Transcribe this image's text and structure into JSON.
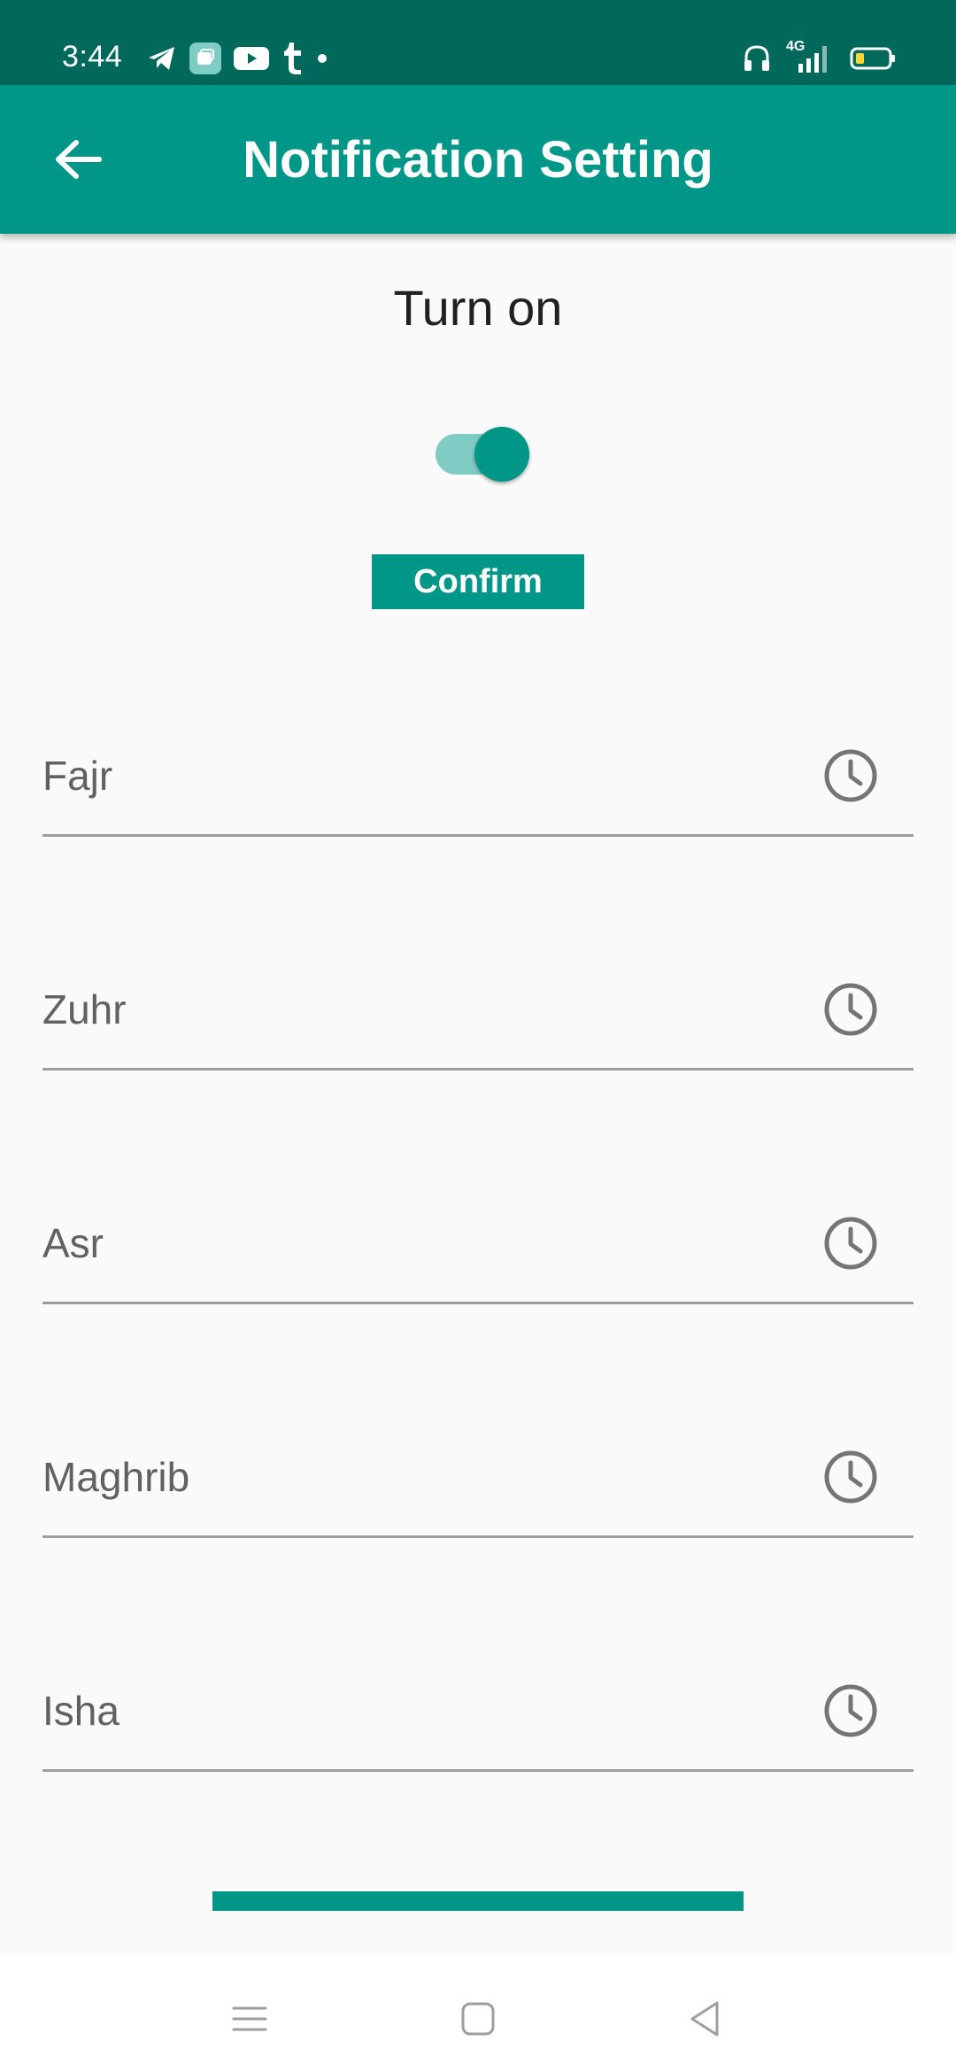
{
  "status_bar": {
    "time": "3:44",
    "left_icons": [
      "telegram-icon",
      "app-icon",
      "youtube-icon",
      "tumblr-icon",
      "dot-icon"
    ],
    "network": "4G",
    "right_icons": [
      "headset-icon",
      "signal-icon",
      "battery-icon"
    ]
  },
  "app_bar": {
    "title": "Notification Setting",
    "back_icon": "arrow-left-icon",
    "background": "#009688"
  },
  "notifications": {
    "label": "Turn on",
    "enabled": true,
    "confirm_label": "Confirm"
  },
  "prayers": [
    {
      "name": "Fajr"
    },
    {
      "name": "Zuhr"
    },
    {
      "name": "Asr"
    },
    {
      "name": "Maghrib"
    },
    {
      "name": "Isha"
    }
  ],
  "colors": {
    "accent": "#009688",
    "status_bar": "#00695c",
    "toggle_track": "#80cbc4"
  },
  "nav_bar": {
    "icons": [
      "menu-icon",
      "home-square-icon",
      "back-triangle-icon"
    ]
  }
}
